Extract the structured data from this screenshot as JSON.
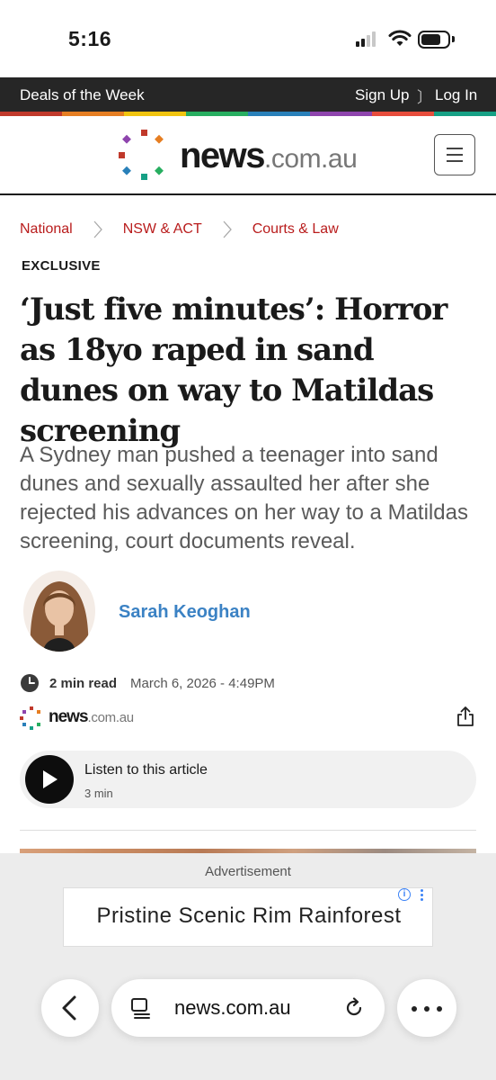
{
  "status_bar": {
    "time": "5:16",
    "battery_level": 0.75
  },
  "top_nav": {
    "deals": "Deals of the Week",
    "sign_up": "Sign Up",
    "divider": "〕",
    "log_in": "Log In"
  },
  "rainbow_colors": [
    "#c0392b",
    "#e67e22",
    "#f1c40f",
    "#27ae60",
    "#2980b9",
    "#8e44ad",
    "#e74c3c",
    "#16a085"
  ],
  "brand": {
    "name": "news",
    "tld": ".com.au"
  },
  "breadcrumb": [
    "National",
    "NSW & ACT",
    "Courts & Law"
  ],
  "kicker": "EXCLUSIVE",
  "headline": "‘Just five minutes’: Horror as 18yo raped in sand dunes on way to Matildas screening",
  "standfirst": "A Sydney man pushed a teenager into sand dunes and sexually assaulted her after she rejected his advances on her way to a Matildas screening, court documents reveal.",
  "author": {
    "name": "Sarah Keoghan"
  },
  "meta": {
    "read_time": "2 min read",
    "date": "March 6, 2026 - 4:49PM"
  },
  "mini_brand": {
    "name": "news",
    "tld": ".com.au"
  },
  "listen": {
    "title": "Listen to this article",
    "duration": "3 min"
  },
  "ad": {
    "label": "Advertisement",
    "text": "Pristine Scenic Rim Rainforest",
    "info_glyph": "i"
  },
  "browser": {
    "url": "news.com.au"
  },
  "colors": {
    "accent_red": "#b91c1c",
    "author_blue": "#3b82c4",
    "ad_blue": "#3b82f6"
  }
}
